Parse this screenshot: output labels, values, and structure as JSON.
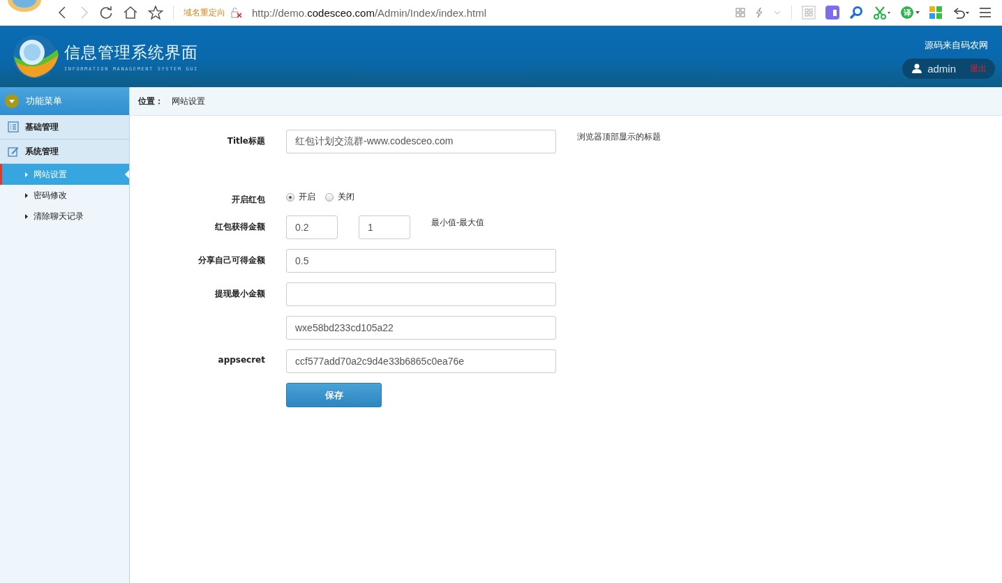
{
  "browser": {
    "redirect_label": "域名重定向",
    "url": {
      "prefix": "http://demo.",
      "domain": "codesceo.com",
      "path": "/Admin/Index/index.html"
    },
    "extensions": [
      {
        "kind": "grid"
      },
      {
        "kind": "purple"
      },
      {
        "kind": "search"
      },
      {
        "kind": "scissors"
      },
      {
        "kind": "translate",
        "label": "译"
      },
      {
        "kind": "tiles"
      }
    ]
  },
  "header": {
    "title": "信息管理系统界面",
    "subtitle": "INFORMATION MANAGEMENT SYSTEM GUI",
    "source_link": "源码来自码农网",
    "user": "admin",
    "logout": "退出"
  },
  "sidebar": {
    "title": "功能菜单",
    "groups": [
      {
        "label": "基础管理"
      },
      {
        "label": "系统管理",
        "children": [
          {
            "label": "网站设置",
            "selected": true
          },
          {
            "label": "密码修改",
            "selected": false
          },
          {
            "label": "清除聊天记录",
            "selected": false
          }
        ]
      }
    ]
  },
  "breadcrumb": {
    "label": "位置：",
    "current": "网站设置"
  },
  "form": {
    "rows": [
      {
        "kind": "text",
        "label": "Title标题",
        "value": "红包计划交流群-www.codesceo.com",
        "hint": "浏览器顶部显示的标题"
      },
      {
        "kind": "radio",
        "label": "开启红包",
        "options": [
          {
            "label": "开启",
            "selected": true
          },
          {
            "label": "关闭",
            "selected": false
          }
        ]
      },
      {
        "kind": "range",
        "label": "红包获得金额",
        "min": "0.2",
        "max": "1",
        "hint": "最小值-最大值"
      },
      {
        "kind": "text",
        "label": "分享自己可得金额",
        "value": "0.5"
      },
      {
        "kind": "text",
        "label": "提现最小金额"
      },
      {
        "kind": "text",
        "value": "wxe58bd233cd105a22"
      },
      {
        "kind": "text",
        "label": "appsecret",
        "value": "ccf577add70a2c9d4e33b6865c0ea76e"
      }
    ],
    "save_button": "保存"
  }
}
